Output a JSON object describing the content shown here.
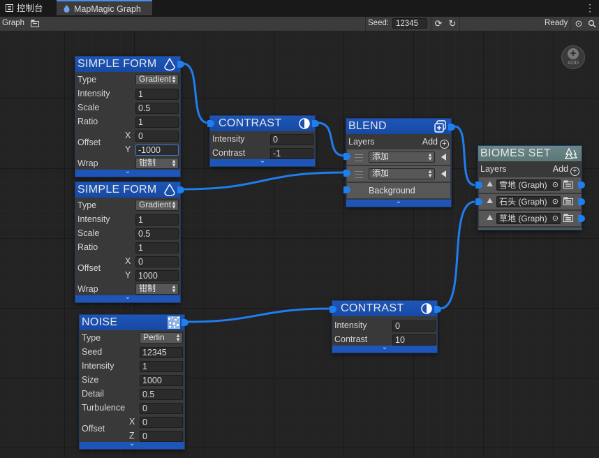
{
  "tabs": [
    {
      "label": "控制台",
      "icon": "list-icon"
    },
    {
      "label": "MapMagic Graph",
      "icon": "mapmagic-icon"
    }
  ],
  "toolbar": {
    "graph_label": "Graph",
    "seed_label": "Seed:",
    "seed_value": "12345",
    "status": "Ready"
  },
  "add_button_label": "ADD",
  "nodes": {
    "simple_form_1": {
      "title": "SIMPLE FORM",
      "type_label": "Type",
      "type_value": "Gradient",
      "intensity_label": "Intensity",
      "intensity": "1",
      "scale_label": "Scale",
      "scale": "0.5",
      "ratio_label": "Ratio",
      "ratio": "1",
      "offset_label": "Offset",
      "x_label": "X",
      "x": "0",
      "y_label": "Y",
      "y": "-1000",
      "wrap_label": "Wrap",
      "wrap_value": "钳制"
    },
    "simple_form_2": {
      "title": "SIMPLE FORM",
      "type_label": "Type",
      "type_value": "Gradient",
      "intensity_label": "Intensity",
      "intensity": "1",
      "scale_label": "Scale",
      "scale": "0.5",
      "ratio_label": "Ratio",
      "ratio": "1",
      "offset_label": "Offset",
      "x_label": "X",
      "x": "0",
      "y_label": "Y",
      "y": "1000",
      "wrap_label": "Wrap",
      "wrap_value": "钳制"
    },
    "noise": {
      "title": "NOISE",
      "type_label": "Type",
      "type_value": "Perlin",
      "seed_label": "Seed",
      "seed": "12345",
      "intensity_label": "Intensity",
      "intensity": "1",
      "size_label": "Size",
      "size": "1000",
      "detail_label": "Detail",
      "detail": "0.5",
      "turbulence_label": "Turbulence",
      "turbulence": "0",
      "offset_label": "Offset",
      "x_label": "X",
      "x": "0",
      "z_label": "Z",
      "z": "0"
    },
    "contrast_1": {
      "title": "CONTRAST",
      "intensity_label": "Intensity",
      "intensity": "0",
      "contrast_label": "Contrast",
      "contrast": "-1"
    },
    "contrast_2": {
      "title": "CONTRAST",
      "intensity_label": "Intensity",
      "intensity": "0",
      "contrast_label": "Contrast",
      "contrast": "10"
    },
    "blend": {
      "title": "BLEND",
      "layers_label": "Layers",
      "add_label": "Add",
      "layer1": "添加",
      "layer2": "添加",
      "background": "Background"
    },
    "biomes_set": {
      "title": "BIOMES SET",
      "layers_label": "Layers",
      "add_label": "Add",
      "biome1": "雪地 (Graph)",
      "biome2": "石头 (Graph)",
      "biome3": "草地 (Graph)"
    }
  },
  "colors": {
    "accent": "#1f7ef0",
    "node_header": "#1d56b8",
    "biomes_header": "#6b8686"
  }
}
